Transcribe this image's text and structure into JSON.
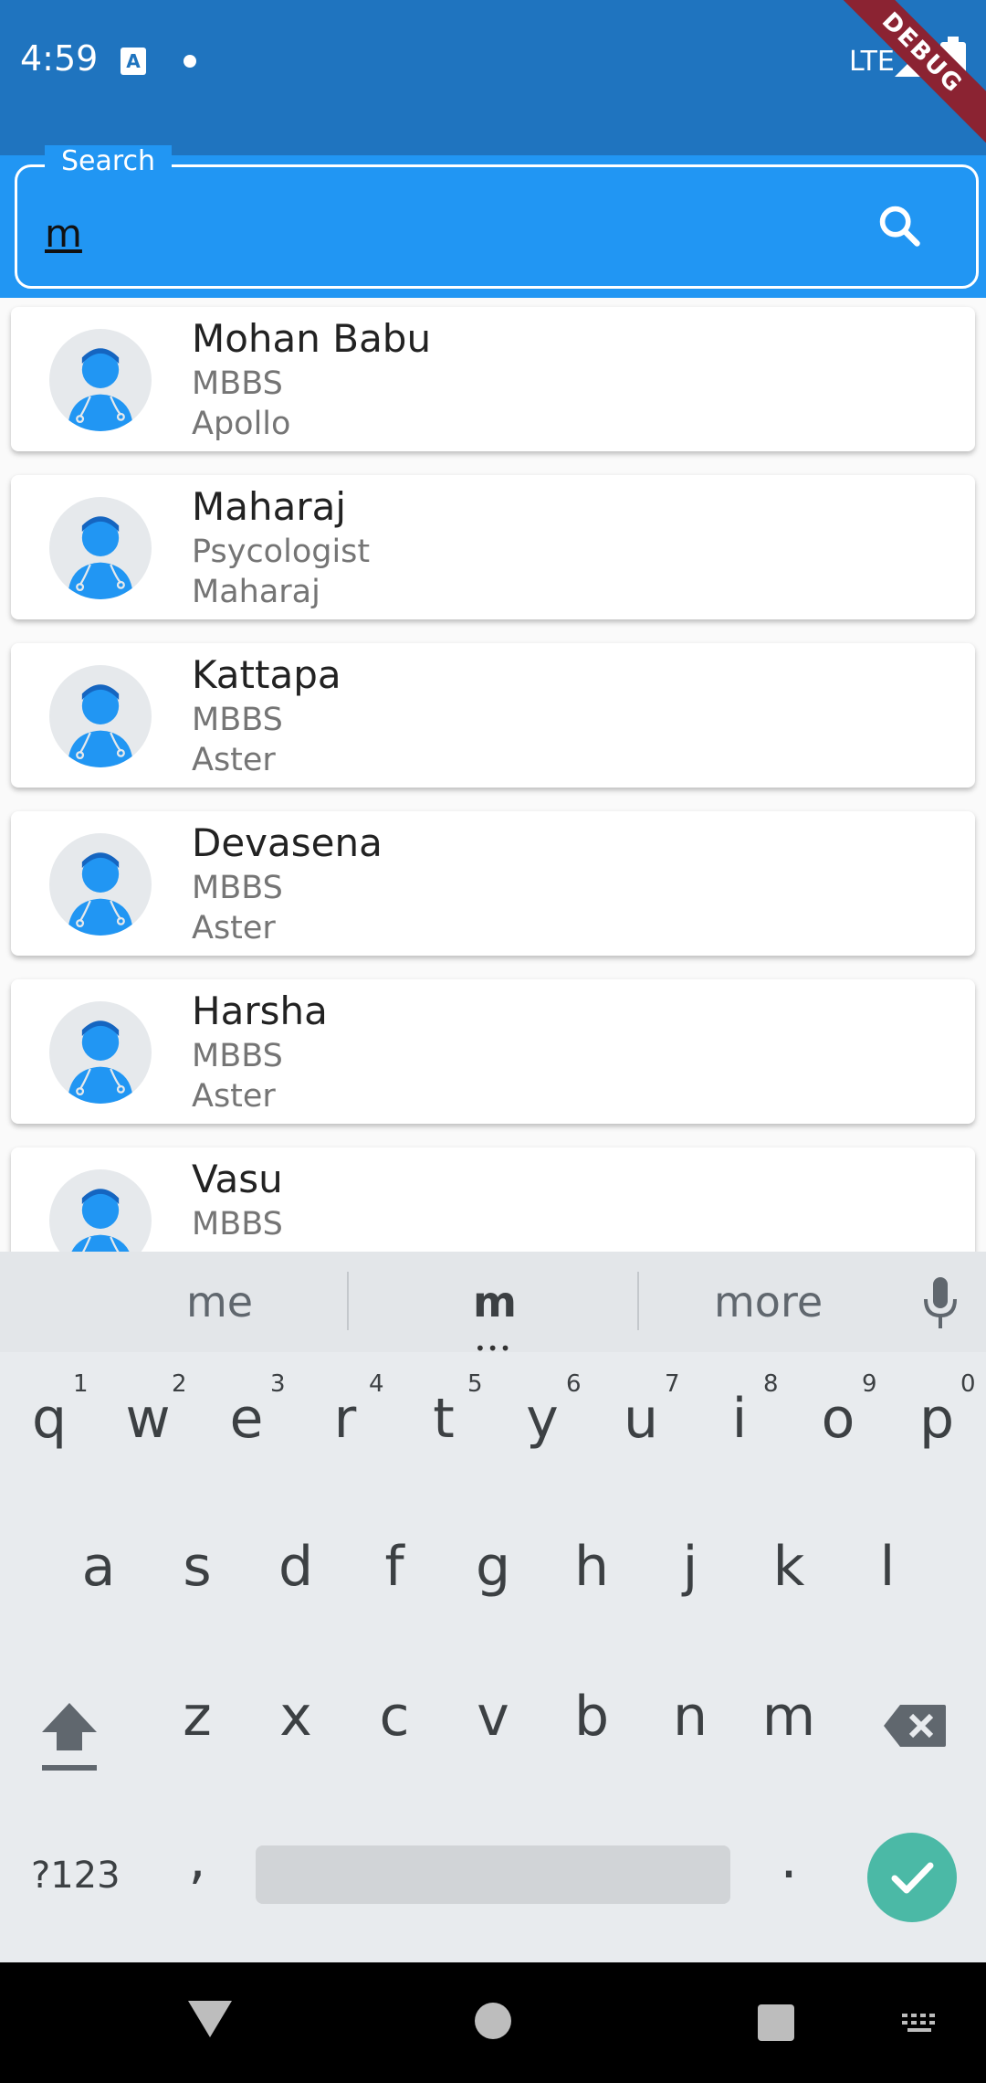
{
  "status_bar": {
    "time": "4:59",
    "network": "LTE",
    "debug_label": "DEBUG"
  },
  "search": {
    "label": "Search",
    "value": "m"
  },
  "doctors": [
    {
      "name": "Mohan Babu",
      "specialty": "MBBS",
      "hospital": "Apollo"
    },
    {
      "name": "Maharaj",
      "specialty": "Psycologist",
      "hospital": "Maharaj"
    },
    {
      "name": "Kattapa",
      "specialty": "MBBS",
      "hospital": "Aster"
    },
    {
      "name": "Devasena",
      "specialty": "MBBS",
      "hospital": "Aster"
    },
    {
      "name": "Harsha",
      "specialty": "MBBS",
      "hospital": "Aster"
    },
    {
      "name": "Vasu",
      "specialty": "MBBS",
      "hospital": ""
    }
  ],
  "keyboard": {
    "suggestions": [
      "me",
      "m",
      "more"
    ],
    "row1": [
      "q",
      "w",
      "e",
      "r",
      "t",
      "y",
      "u",
      "i",
      "o",
      "p"
    ],
    "row1_hints": [
      "1",
      "2",
      "3",
      "4",
      "5",
      "6",
      "7",
      "8",
      "9",
      "0"
    ],
    "row2": [
      "a",
      "s",
      "d",
      "f",
      "g",
      "h",
      "j",
      "k",
      "l"
    ],
    "row3": [
      "z",
      "x",
      "c",
      "v",
      "b",
      "n",
      "m"
    ],
    "symbols_label": "?123",
    "comma": ",",
    "period": "."
  },
  "colors": {
    "primary_dark": "#1f74bf",
    "primary": "#2196f3",
    "enter": "#4bb9a6",
    "debug": "#8b2332"
  }
}
